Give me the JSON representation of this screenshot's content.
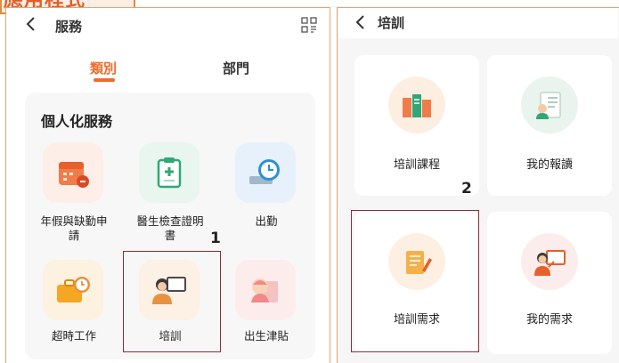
{
  "caption": {
    "text": "應用程式"
  },
  "left_screen": {
    "header": {
      "back_icon": "chevron-left",
      "title": "服務",
      "scan_icon": "scan-icon"
    },
    "tabs": [
      {
        "label": "類別",
        "active": true
      },
      {
        "label": "部門",
        "active": false
      }
    ],
    "section_title": "個人化服務",
    "services": [
      {
        "label": "年假與缺勤申請",
        "icon": "calendar-icon",
        "color": "#f07c4a"
      },
      {
        "label": "醫生檢查證明書",
        "icon": "medical-certificate-icon",
        "color": "#2fa776"
      },
      {
        "label": "出勤",
        "icon": "clock-laptop-icon",
        "color": "#2e8fd6"
      },
      {
        "label": "超時工作",
        "icon": "briefcase-clock-icon",
        "color": "#f5a623"
      },
      {
        "label": "培訓",
        "icon": "trainer-board-icon",
        "color": "#e8913f"
      },
      {
        "label": "出生津貼",
        "icon": "baby-icon",
        "color": "#f0898a"
      }
    ],
    "step_marker": "1"
  },
  "right_screen": {
    "header": {
      "back_icon": "chevron-left",
      "title": "培訓"
    },
    "cards": [
      {
        "label": "培訓課程",
        "icon": "books-icon"
      },
      {
        "label": "我的報讀",
        "icon": "form-person-icon"
      },
      {
        "label": "培訓需求",
        "icon": "notepad-pen-icon"
      },
      {
        "label": "我的需求",
        "icon": "presenter-board-icon"
      }
    ],
    "step_marker": "2"
  }
}
